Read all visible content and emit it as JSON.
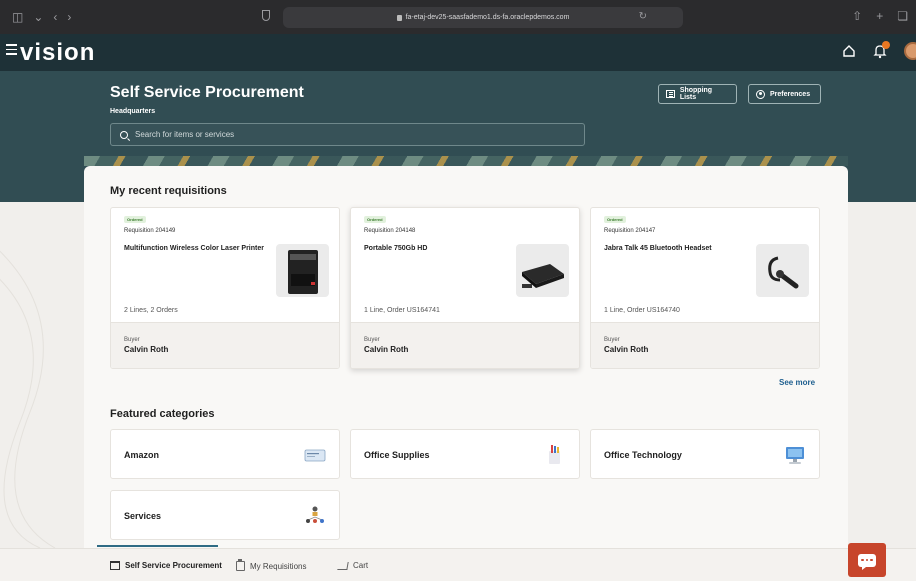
{
  "browser": {
    "url": "fa-etaj-dev25-saasfademo1.ds-fa.oraclepdemos.com"
  },
  "app": {
    "logo": "vision"
  },
  "header": {
    "title": "Self Service Procurement",
    "subtitle": "Headquarters",
    "search_placeholder": "Search for items or services",
    "shopping_lists_label": "Shopping Lists",
    "preferences_label": "Preferences"
  },
  "recent": {
    "title": "My recent requisitions",
    "see_more": "See more",
    "items": [
      {
        "status": "Ordered",
        "number": "Requisition 204149",
        "name": "Multifunction Wireless Color Laser Printer",
        "lines": "2 Lines, 2 Orders",
        "buyer_label": "Buyer",
        "buyer": "Calvin Roth",
        "image_icon": "printer-image"
      },
      {
        "status": "Ordered",
        "number": "Requisition 204148",
        "name": "Portable 750Gb HD",
        "lines": "1 Line, Order US164741",
        "buyer_label": "Buyer",
        "buyer": "Calvin Roth",
        "image_icon": "hard-drive-image"
      },
      {
        "status": "Ordered",
        "number": "Requisition 204147",
        "name": "Jabra Talk 45 Bluetooth Headset",
        "lines": "1 Line, Order US164740",
        "buyer_label": "Buyer",
        "buyer": "Calvin Roth",
        "image_icon": "headset-image"
      }
    ]
  },
  "featured": {
    "title": "Featured categories",
    "items": [
      {
        "label": "Amazon",
        "icon": "amazon-card-icon"
      },
      {
        "label": "Office Supplies",
        "icon": "office-supplies-icon"
      },
      {
        "label": "Office Technology",
        "icon": "computer-icon"
      },
      {
        "label": "Services",
        "icon": "org-chart-icon"
      }
    ]
  },
  "bottom_nav": {
    "items": [
      {
        "label": "Self Service Procurement",
        "icon": "store-icon",
        "active": true
      },
      {
        "label": "My Requisitions",
        "icon": "clipboard-icon",
        "active": false
      },
      {
        "label": "Cart",
        "icon": "cart-icon",
        "active": false
      }
    ]
  },
  "colors": {
    "header_bg": "#1e3137",
    "banner_bg": "#314d53",
    "status_green": "#3a7b2d",
    "chat_button": "#c7452b",
    "link": "#1f5f8f"
  }
}
